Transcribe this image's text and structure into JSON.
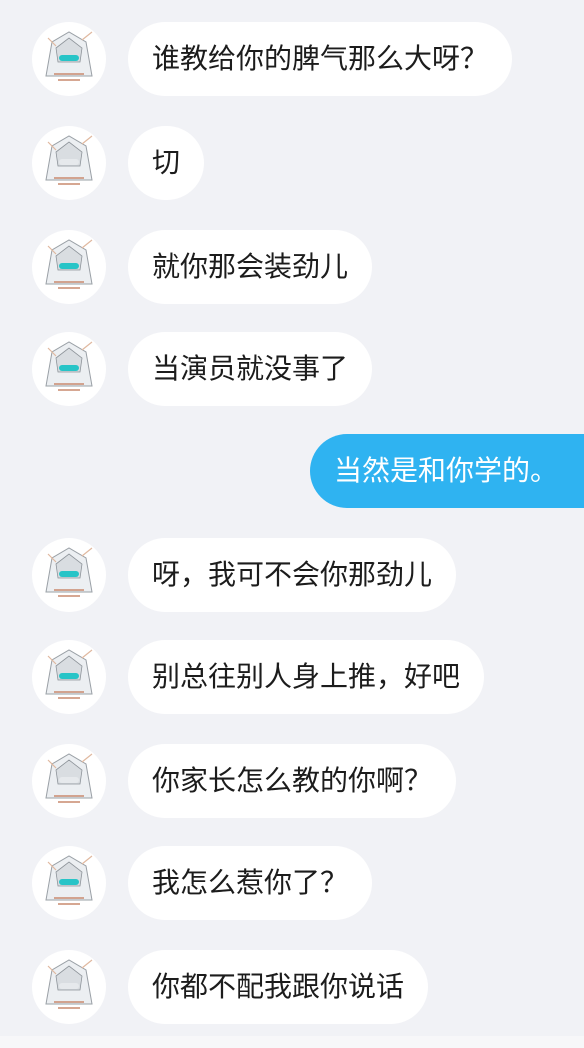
{
  "chat": {
    "messages": [
      {
        "side": "in",
        "text": "谁教给你的脾气那么大呀？"
      },
      {
        "side": "in",
        "text": "切"
      },
      {
        "side": "in",
        "text": "就你那会装劲儿"
      },
      {
        "side": "in",
        "text": "当演员就没事了"
      },
      {
        "side": "out",
        "text": "当然是和你学的。"
      },
      {
        "side": "in",
        "text": "呀，我可不会你那劲儿"
      },
      {
        "side": "in",
        "text": "别总往别人身上推，好吧"
      },
      {
        "side": "in",
        "text": "你家长怎么教的你啊？"
      },
      {
        "side": "in",
        "text": "我怎么惹你了？"
      },
      {
        "side": "in",
        "text": "你都不配我跟你说话"
      }
    ]
  },
  "colors": {
    "background": "#f1f2f6",
    "incoming_bubble": "#ffffff",
    "outgoing_bubble": "#2fb3f1"
  }
}
